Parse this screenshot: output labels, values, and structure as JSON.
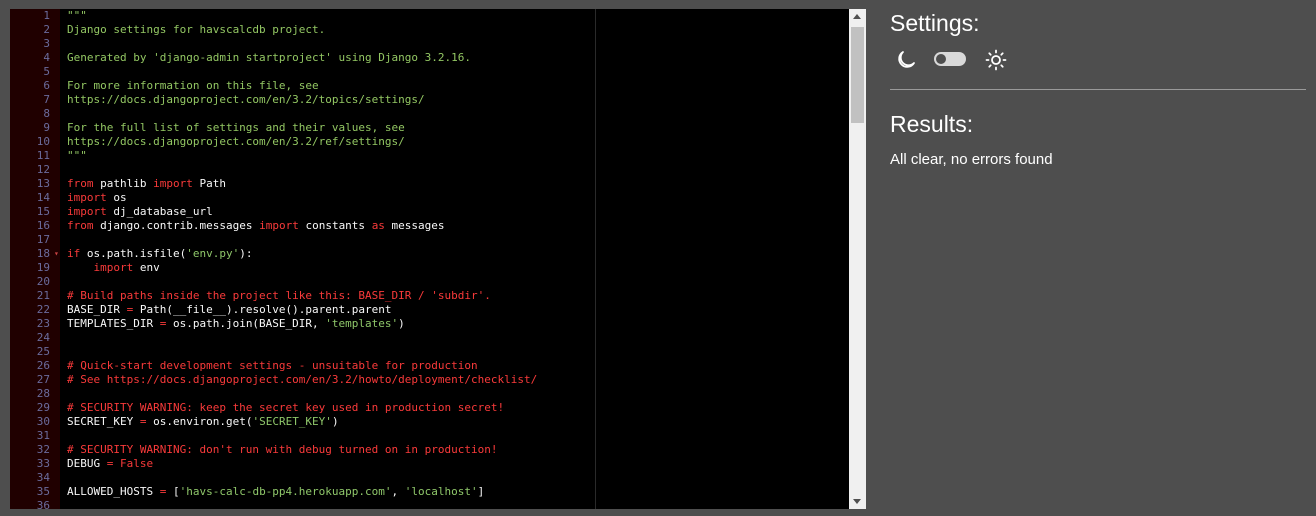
{
  "editor": {
    "lines": [
      {
        "n": "1",
        "parts": [
          {
            "t": "\"\"\"",
            "c": "doc"
          }
        ]
      },
      {
        "n": "2",
        "parts": [
          {
            "t": "Django settings for havscalcdb project.",
            "c": "doc"
          }
        ]
      },
      {
        "n": "3",
        "parts": []
      },
      {
        "n": "4",
        "parts": [
          {
            "t": "Generated by 'django-admin startproject' using Django 3.2.16.",
            "c": "doc"
          }
        ]
      },
      {
        "n": "5",
        "parts": []
      },
      {
        "n": "6",
        "parts": [
          {
            "t": "For more information on this file, see",
            "c": "doc"
          }
        ]
      },
      {
        "n": "7",
        "parts": [
          {
            "t": "https://docs.djangoproject.com/en/3.2/topics/settings/",
            "c": "doc"
          }
        ]
      },
      {
        "n": "8",
        "parts": []
      },
      {
        "n": "9",
        "parts": [
          {
            "t": "For the full list of settings and their values, see",
            "c": "doc"
          }
        ]
      },
      {
        "n": "10",
        "parts": [
          {
            "t": "https://docs.djangoproject.com/en/3.2/ref/settings/",
            "c": "doc"
          }
        ]
      },
      {
        "n": "11",
        "parts": [
          {
            "t": "\"\"\"",
            "c": "doc"
          }
        ]
      },
      {
        "n": "12",
        "parts": []
      },
      {
        "n": "13",
        "parts": [
          {
            "t": "from",
            "c": "kw"
          },
          {
            "t": " pathlib ",
            "c": ""
          },
          {
            "t": "import",
            "c": "kw"
          },
          {
            "t": " Path",
            "c": ""
          }
        ]
      },
      {
        "n": "14",
        "parts": [
          {
            "t": "import",
            "c": "kw"
          },
          {
            "t": " os",
            "c": ""
          }
        ]
      },
      {
        "n": "15",
        "parts": [
          {
            "t": "import",
            "c": "kw"
          },
          {
            "t": " dj_database_url",
            "c": ""
          }
        ]
      },
      {
        "n": "16",
        "parts": [
          {
            "t": "from",
            "c": "kw"
          },
          {
            "t": " django.contrib.messages ",
            "c": ""
          },
          {
            "t": "import",
            "c": "kw"
          },
          {
            "t": " constants ",
            "c": ""
          },
          {
            "t": "as",
            "c": "kw"
          },
          {
            "t": " messages",
            "c": ""
          }
        ]
      },
      {
        "n": "17",
        "parts": []
      },
      {
        "n": "18",
        "fold": true,
        "parts": [
          {
            "t": "if",
            "c": "kw"
          },
          {
            "t": " os.path.isfile(",
            "c": ""
          },
          {
            "t": "'env.py'",
            "c": "str"
          },
          {
            "t": "):",
            "c": ""
          }
        ]
      },
      {
        "n": "19",
        "parts": [
          {
            "t": "    ",
            "c": ""
          },
          {
            "t": "import",
            "c": "kw"
          },
          {
            "t": " env",
            "c": ""
          }
        ]
      },
      {
        "n": "20",
        "parts": []
      },
      {
        "n": "21",
        "parts": [
          {
            "t": "# Build paths inside the project like this: BASE_DIR / 'subdir'.",
            "c": "cmt"
          }
        ]
      },
      {
        "n": "22",
        "parts": [
          {
            "t": "BASE_DIR ",
            "c": ""
          },
          {
            "t": "=",
            "c": "op"
          },
          {
            "t": " Path(__file__).resolve().parent.parent",
            "c": ""
          }
        ]
      },
      {
        "n": "23",
        "parts": [
          {
            "t": "TEMPLATES_DIR ",
            "c": ""
          },
          {
            "t": "=",
            "c": "op"
          },
          {
            "t": " os.path.join(BASE_DIR, ",
            "c": ""
          },
          {
            "t": "'templates'",
            "c": "str"
          },
          {
            "t": ")",
            "c": ""
          }
        ]
      },
      {
        "n": "24",
        "parts": []
      },
      {
        "n": "25",
        "parts": []
      },
      {
        "n": "26",
        "parts": [
          {
            "t": "# Quick-start development settings - unsuitable for production",
            "c": "cmt"
          }
        ]
      },
      {
        "n": "27",
        "parts": [
          {
            "t": "# See https://docs.djangoproject.com/en/3.2/howto/deployment/checklist/",
            "c": "cmt"
          }
        ]
      },
      {
        "n": "28",
        "parts": []
      },
      {
        "n": "29",
        "parts": [
          {
            "t": "# SECURITY WARNING: keep the secret key used in production secret!",
            "c": "cmt"
          }
        ]
      },
      {
        "n": "30",
        "parts": [
          {
            "t": "SECRET_KEY ",
            "c": ""
          },
          {
            "t": "=",
            "c": "op"
          },
          {
            "t": " os.environ.get(",
            "c": ""
          },
          {
            "t": "'SECRET_KEY'",
            "c": "str"
          },
          {
            "t": ")",
            "c": ""
          }
        ]
      },
      {
        "n": "31",
        "parts": []
      },
      {
        "n": "32",
        "parts": [
          {
            "t": "# SECURITY WARNING: don't run with debug turned on in production!",
            "c": "cmt"
          }
        ]
      },
      {
        "n": "33",
        "parts": [
          {
            "t": "DEBUG ",
            "c": ""
          },
          {
            "t": "=",
            "c": "op"
          },
          {
            "t": " ",
            "c": ""
          },
          {
            "t": "False",
            "c": "kw"
          }
        ]
      },
      {
        "n": "34",
        "parts": []
      },
      {
        "n": "35",
        "parts": [
          {
            "t": "ALLOWED_HOSTS ",
            "c": ""
          },
          {
            "t": "=",
            "c": "op"
          },
          {
            "t": " [",
            "c": ""
          },
          {
            "t": "'havs-calc-db-pp4.herokuapp.com'",
            "c": "str"
          },
          {
            "t": ", ",
            "c": ""
          },
          {
            "t": "'localhost'",
            "c": "str"
          },
          {
            "t": "]",
            "c": ""
          }
        ]
      },
      {
        "n": "36",
        "parts": []
      }
    ]
  },
  "settings": {
    "title": "Settings:",
    "moon_icon": "moon-icon",
    "sun_icon": "sun-icon",
    "theme_toggle_state": "off"
  },
  "results": {
    "title": "Results:",
    "message": "All clear, no errors found"
  }
}
